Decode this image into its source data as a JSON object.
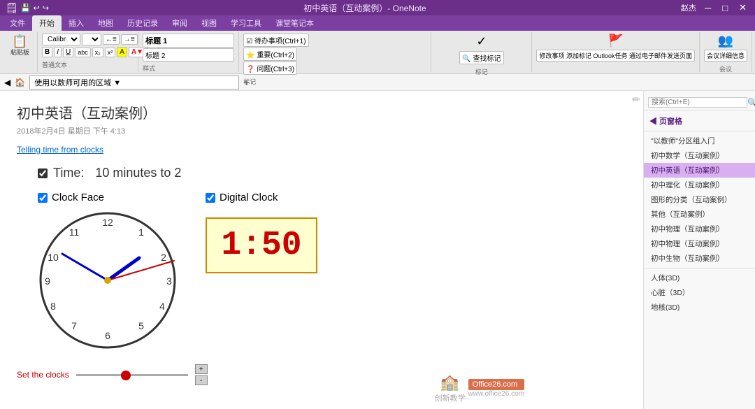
{
  "titleBar": {
    "title": "初中英语（互动案例）- OneNote",
    "user": "赵杰",
    "minBtn": "─",
    "maxBtn": "□",
    "closeBtn": "✕"
  },
  "ribbonTabs": [
    {
      "label": "文件",
      "active": false
    },
    {
      "label": "开始",
      "active": true
    },
    {
      "label": "插入",
      "active": false
    },
    {
      "label": "地图",
      "active": false
    },
    {
      "label": "历史记录",
      "active": false
    },
    {
      "label": "审阅",
      "active": false
    },
    {
      "label": "视图",
      "active": false
    },
    {
      "label": "学习工具",
      "active": false
    },
    {
      "label": "课堂笔记本",
      "active": false
    }
  ],
  "addressBar": {
    "path": "使用以数师可用的区域 ▼",
    "addBtn": "+"
  },
  "page": {
    "title": "初中英语（互动案例）",
    "meta": "2018年2月4日  星期日    下午 4:13",
    "link": "Telling time from clocks"
  },
  "timeDisplay": {
    "checkboxLabel": "Time:",
    "timeText": "10 minutes to 2"
  },
  "analogClock": {
    "checkboxLabel": "Clock Face",
    "checked": true
  },
  "digitalClock": {
    "checkboxLabel": "Digital Clock",
    "checked": true,
    "display": "1:50"
  },
  "sliderArea": {
    "label": "Set the clocks",
    "plusBtn": "+",
    "minusBtn": "-"
  },
  "sidebar": {
    "searchPlaceholder": "搜索(Ctrl+E)",
    "sectionTitle": "◀ 页窗格",
    "items": [
      {
        "label": "\"以教师\"分区组入门",
        "active": false
      },
      {
        "label": "初中数学（互动案例）",
        "active": false
      },
      {
        "label": "初中英语（互动案例）",
        "active": true
      },
      {
        "label": "初中理化（互动案例）",
        "active": false
      },
      {
        "label": "图形的分类（互动案例）",
        "active": false
      },
      {
        "label": "其他（互动案例）",
        "active": false
      },
      {
        "label": "初中物理（互动案例）",
        "active": false
      },
      {
        "label": "初中物理（互动案例）",
        "active": false
      },
      {
        "label": "初中生物（互动案例）",
        "active": false
      },
      {
        "label": "人体(3D)",
        "active": false
      },
      {
        "label": "心脏（3D）",
        "active": false
      },
      {
        "label": "地核(3D)",
        "active": false
      }
    ]
  },
  "watermark": {
    "text1": "创新教学",
    "text2": "Office26.com",
    "text3": "www.office26.com"
  }
}
